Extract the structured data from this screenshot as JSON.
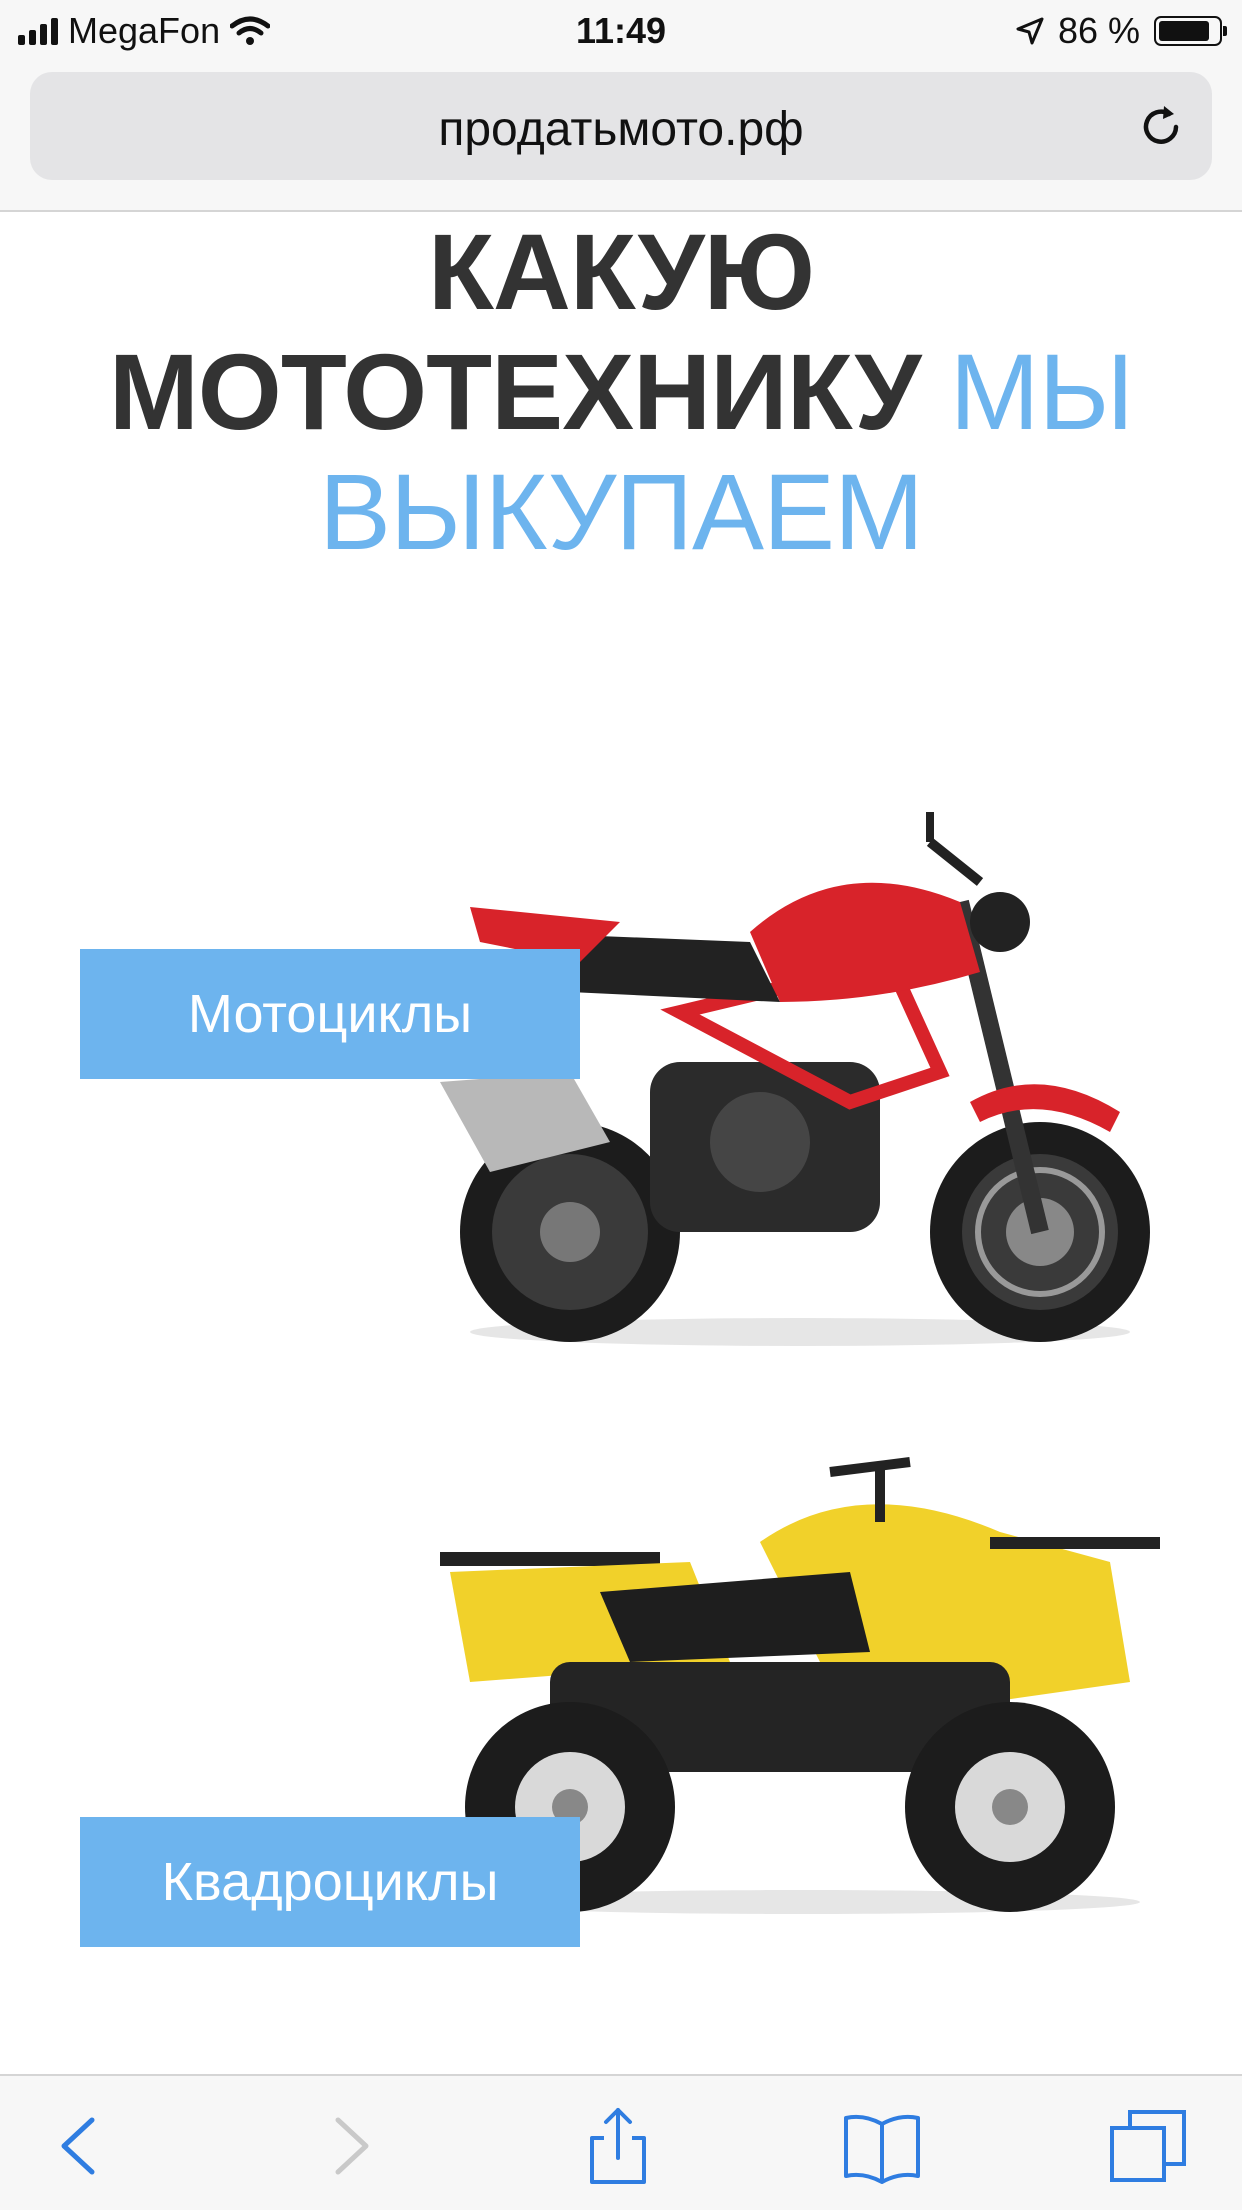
{
  "status_bar": {
    "carrier": "MegaFon",
    "time": "11:49",
    "battery_percent": "86 %",
    "battery_level": 0.86
  },
  "browser": {
    "url": "продатьмото.рф"
  },
  "main": {
    "heading_bold": "КАКУЮ МОТОТЕХНИКУ",
    "heading_light_1": "МЫ",
    "heading_light_2": "ВЫКУПАЕМ",
    "categories": [
      {
        "label": "Мотоциклы"
      },
      {
        "label": "Квадроциклы"
      }
    ]
  },
  "colors": {
    "accent": "#6db4ee",
    "heading": "#333333",
    "motorcycle_body": "#d8232a",
    "atv_body": "#f1d12a"
  }
}
